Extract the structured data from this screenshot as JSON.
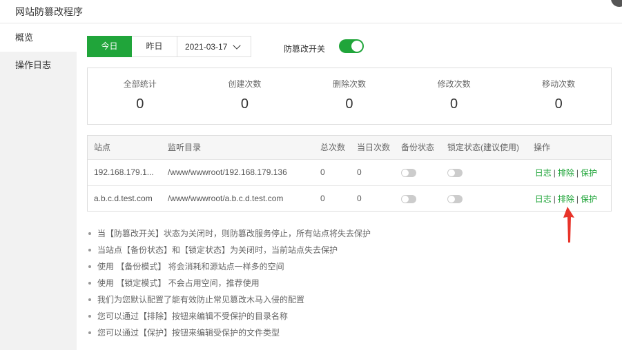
{
  "window": {
    "title": "网站防篡改程序"
  },
  "sidebar": {
    "items": [
      {
        "label": "概览"
      },
      {
        "label": "操作日志"
      }
    ]
  },
  "toolbar": {
    "today_label": "今日",
    "yesterday_label": "昨日",
    "date_value": "2021-03-17",
    "switch_label": "防篡改开关",
    "switch_on": true
  },
  "stats": [
    {
      "label": "全部统计",
      "value": "0"
    },
    {
      "label": "创建次数",
      "value": "0"
    },
    {
      "label": "删除次数",
      "value": "0"
    },
    {
      "label": "修改次数",
      "value": "0"
    },
    {
      "label": "移动次数",
      "value": "0"
    }
  ],
  "table": {
    "headers": [
      "站点",
      "监听目录",
      "总次数",
      "当日次数",
      "备份状态",
      "锁定状态(建议使用)",
      "操作"
    ],
    "rows": [
      {
        "site": "192.168.179.1...",
        "dir": "/www/wwwroot/192.168.179.136",
        "total": "0",
        "today": "0"
      },
      {
        "site": "a.b.c.d.test.com",
        "dir": "/www/wwwroot/a.b.c.d.test.com",
        "total": "0",
        "today": "0"
      }
    ],
    "ops": {
      "log": "日志",
      "exclude": "排除",
      "protect": "保护",
      "sep": "|"
    }
  },
  "notes": [
    "当【防篡改开关】状态为关闭时，则防篡改服务停止，所有站点将失去保护",
    "当站点【备份状态】和【锁定状态】为关闭时，当前站点失去保护",
    "使用 【备份模式】 将会消耗和源站点一样多的空间",
    "使用 【锁定模式】 不会占用空间，推荐使用",
    "我们为您默认配置了能有效防止常见篡改木马入侵的配置",
    "您可以通过【排除】按钮来编辑不受保护的目录名称",
    "您可以通过【保护】按钮来编辑受保护的文件类型"
  ],
  "colors": {
    "accent": "#20a53a",
    "annotation_arrow": "#e8342a"
  }
}
